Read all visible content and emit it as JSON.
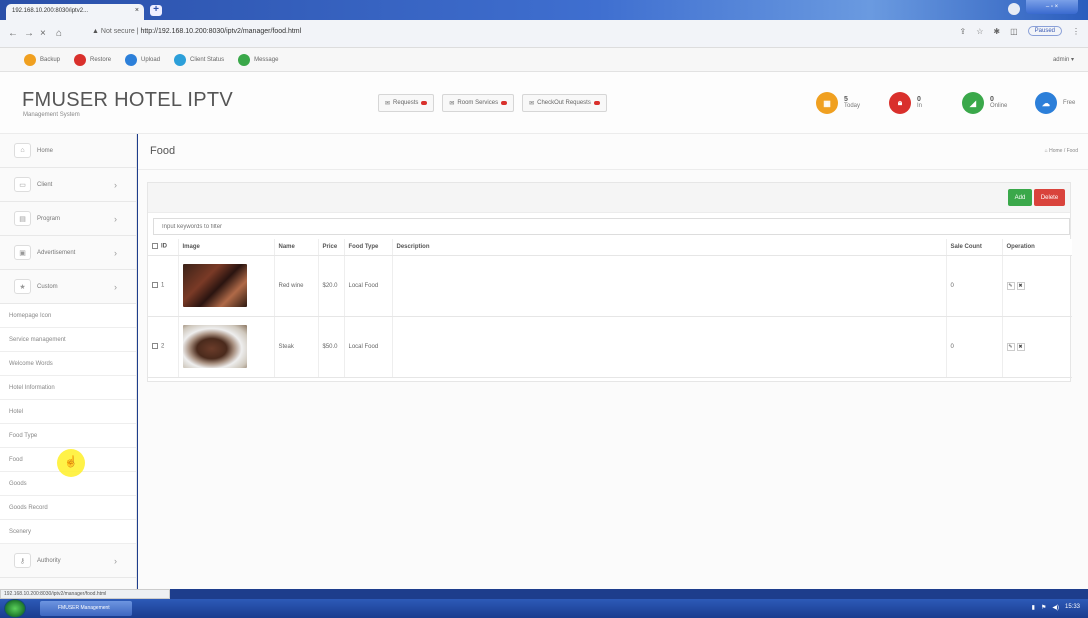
{
  "browser": {
    "tab_title": "192.168.10.200:8030/iptv2...",
    "tab_close": "×",
    "new_tab": "+",
    "window_controls": "– ▫ ×",
    "security_label": "Not secure",
    "url": "http://192.168.10.200:8030/iptv2/manager/food.html",
    "paused_label": "Paused",
    "status_url": "192.168.10.200:8030/iptv2/manager/food.html"
  },
  "bookmarks": [
    {
      "label": "Backup",
      "color": "#f0a020"
    },
    {
      "label": "Restore",
      "color": "#d9302c"
    },
    {
      "label": "Upload",
      "color": "#2c7fd9"
    },
    {
      "label": "Client Status",
      "color": "#2c9fd9"
    },
    {
      "label": "Message",
      "color": "#3aa84a"
    }
  ],
  "user_menu": "admin ▾",
  "header": {
    "brand": "FMUSER HOTEL IPTV",
    "subtitle": "Management System",
    "buttons": [
      "Requests",
      "Room Services",
      "CheckOut Requests"
    ],
    "stats": [
      {
        "value": "5",
        "label": "Today",
        "color": "#f0a020",
        "icon": "calendar-icon"
      },
      {
        "value": "0",
        "label": "In",
        "color": "#d9302c",
        "icon": "lock-icon"
      },
      {
        "value": "0",
        "label": "Online",
        "color": "#3aa84a",
        "icon": "chart-icon"
      },
      {
        "value": "",
        "label": "Free",
        "color": "#2c7fd9",
        "icon": "cloud-icon"
      }
    ]
  },
  "sidebar": {
    "main_items": [
      {
        "label": "Home",
        "icon": "home-icon"
      },
      {
        "label": "Client",
        "icon": "monitor-icon"
      },
      {
        "label": "Program",
        "icon": "film-icon"
      },
      {
        "label": "Advertisement",
        "icon": "ad-icon"
      },
      {
        "label": "Custom",
        "icon": "star-icon"
      }
    ],
    "sub_items": [
      "Homepage Icon",
      "Service management",
      "Welcome Words",
      "Hotel Information",
      "Hotel",
      "Food Type",
      "Food",
      "Goods",
      "Goods Record",
      "Scenery"
    ],
    "bottom_item": {
      "label": "Authority",
      "icon": "key-icon"
    }
  },
  "main": {
    "title": "Food",
    "breadcrumb": "Home / Food",
    "add_label": "Add",
    "delete_label": "Delete",
    "filter_placeholder": "Input keywords to filter",
    "columns": [
      "ID",
      "Image",
      "Name",
      "Price",
      "Food Type",
      "Description",
      "Sale Count",
      "Operation"
    ],
    "rows": [
      {
        "id": "1",
        "name": "Red wine",
        "price": "$20.0",
        "type": "Local Food",
        "description": "",
        "sale_count": "0"
      },
      {
        "id": "2",
        "name": "Steak",
        "price": "$50.0",
        "type": "Local Food",
        "description": "",
        "sale_count": "0"
      }
    ]
  },
  "taskbar": {
    "app_label": "FMUSER Management",
    "clock": "15:33"
  }
}
